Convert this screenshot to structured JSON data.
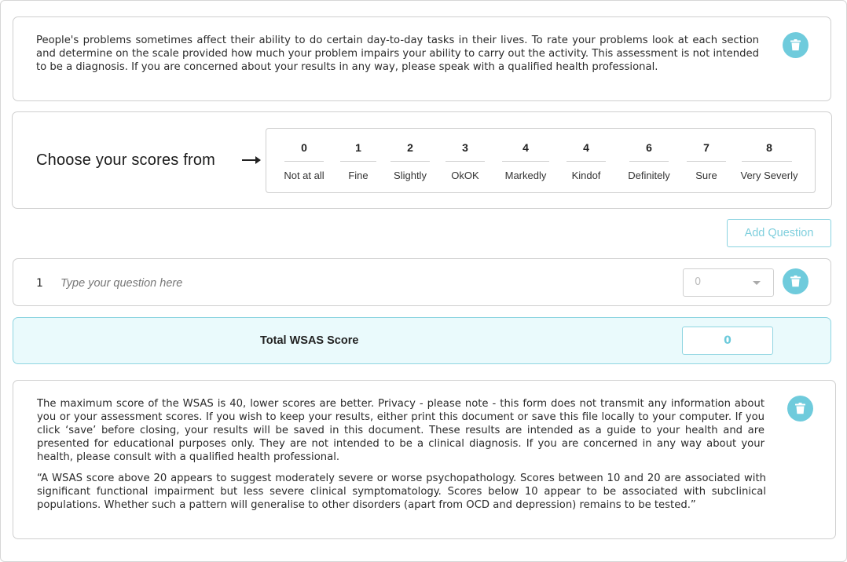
{
  "intro": {
    "text": "People's problems sometimes affect their ability to do certain day-to-day tasks in their lives.  To rate your problems look at each section and determine on the scale provided how much your problem impairs your ability to carry out the activity. This assessment is not intended to be a diagnosis. If you are concerned about your results in any way, please speak with a qualified health professional.",
    "delete_icon": "trash-icon"
  },
  "scale": {
    "label": "Choose your scores from",
    "arrow_icon": "arrow-right-icon",
    "items": [
      {
        "score": "0",
        "label": "Not at all"
      },
      {
        "score": "1",
        "label": "Fine"
      },
      {
        "score": "2",
        "label": "Slightly"
      },
      {
        "score": "3",
        "label": "OkOK"
      },
      {
        "score": "4",
        "label": "Markedly"
      },
      {
        "score": "4",
        "label": "Kindof"
      },
      {
        "score": "6",
        "label": "Definitely"
      },
      {
        "score": "7",
        "label": "Sure"
      },
      {
        "score": "8",
        "label": "Very Severly"
      }
    ]
  },
  "actions": {
    "add_question_label": "Add Question"
  },
  "question": {
    "number": "1",
    "placeholder": "Type your question here",
    "value": "",
    "selected_score": "0",
    "delete_icon": "trash-icon"
  },
  "total": {
    "label": "Total WSAS Score",
    "value": "0"
  },
  "info": {
    "paragraph1": "The maximum score of the WSAS is 40, lower scores are better. Privacy - please note - this form does not transmit any information about you or your assessment scores. If you wish to keep your results, either print this document or save this file locally to your computer.  If  you  click ‘save’ before closing, your results will be saved in this document. These results are intended as a guide to your health and are presented  for  educational  purposes  only.  They  are  not  intended  to  be  a  clinical diagnosis.  If  you  are concerned in any way about your health, please consult with a qualified health professional.",
    "paragraph2": "“A WSAS score above 20 appears to suggest moderately severe or worse psychopathology.  Scores between 10 and 20 are associated with significant functional impairment but less severe clinical symptomatology.  Scores below 10 appear to be associated with subclinical populations.  Whether such a pattern will generalise to other disorders (apart from OCD and depression) remains to be tested.”",
    "delete_icon": "trash-icon"
  },
  "colors": {
    "accent": "#6fcbdc",
    "total_bg": "#eafafc",
    "border": "#cfcfcf"
  }
}
